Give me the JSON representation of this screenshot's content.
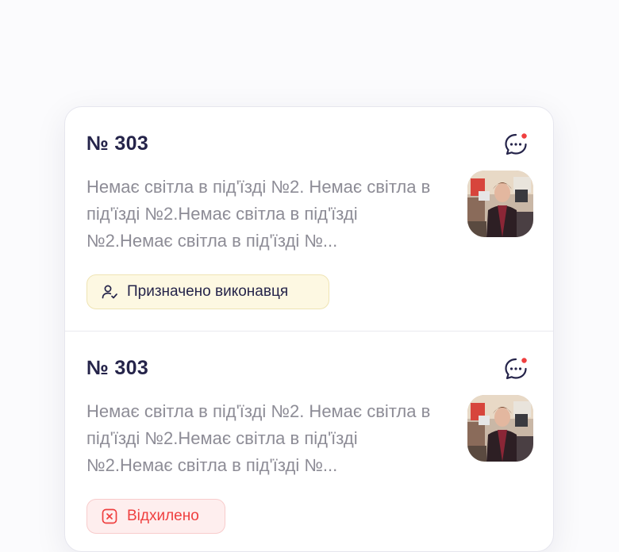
{
  "requests": [
    {
      "number": "№ 303",
      "description": "Немає світла в під'їзді №2. Немає світла в під'їзді №2.Немає світла в під'їзді №2.Немає світла в під'їзді №...",
      "status": "Призначено виконавця",
      "status_icon": "user-check-icon",
      "status_color": "#fdf8e2"
    },
    {
      "number": "№ 303",
      "description": "Немає світла в під'їзді №2. Немає світла в під'їзді №2.Немає світла в під'їзді №2.Немає світла в під'їзді №...",
      "status": "Відхилено",
      "status_icon": "close-square-icon",
      "status_color": "#ef3f3f"
    }
  ],
  "colors": {
    "title": "#25244a",
    "description": "#8d8c96",
    "notification_dot": "#ef3f3f"
  }
}
